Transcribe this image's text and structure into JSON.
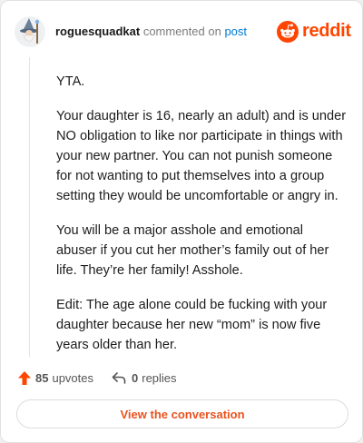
{
  "header": {
    "username": "roguesquadkat",
    "action": "commented on",
    "post_link": "post",
    "brand": "reddit"
  },
  "comment": {
    "paragraphs": [
      "YTA.",
      "Your daughter is 16, nearly an adult) and is under NO obligation to like nor participate in things with your new partner. You can not punish someone for not wanting to put themselves into a group setting they would be uncomfortable or angry in.",
      "You will be a major asshole and emotional abuser if you cut her mother’s family out of her life. They’re her family! Asshole.",
      "Edit: The age alone could be fucking with your daughter because her new “mom” is now five years older than her."
    ]
  },
  "actions": {
    "upvotes_count": "85",
    "upvotes_label": "upvotes",
    "replies_count": "0",
    "replies_label": "replies"
  },
  "view_button": "View the conversation",
  "colors": {
    "brand": "#ff4500",
    "link": "#0079d3",
    "button_text": "#e8531f"
  }
}
